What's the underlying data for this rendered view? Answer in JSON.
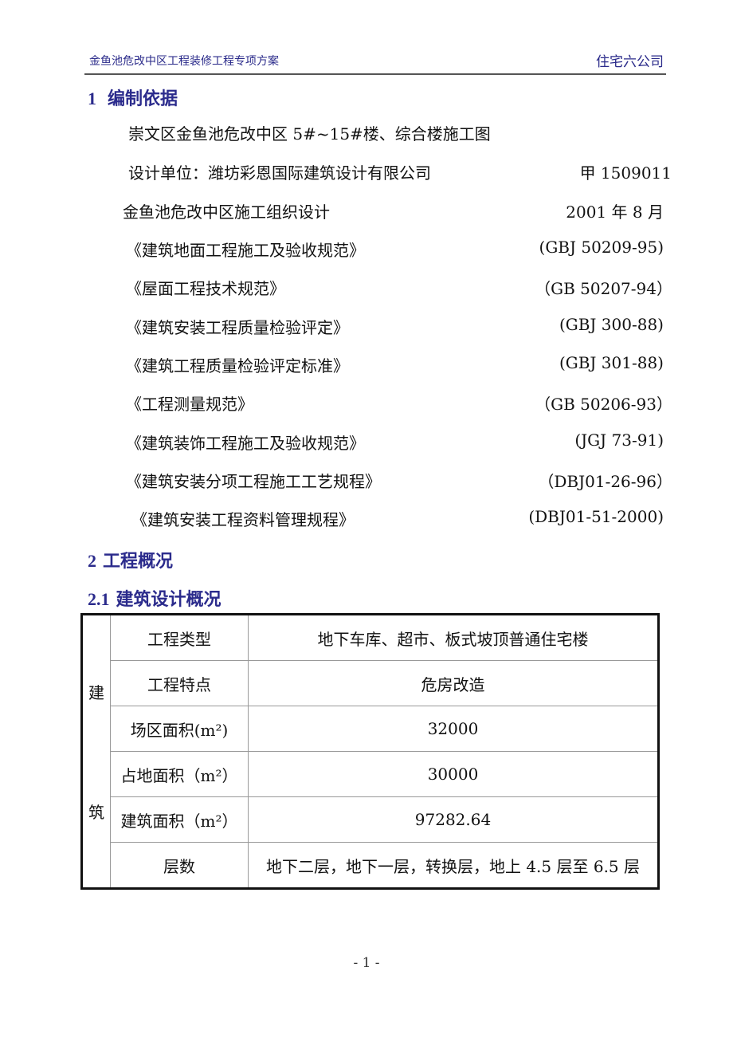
{
  "header": {
    "left": "金鱼池危改中区工程装修工程专项方案",
    "right": "住宅六公司"
  },
  "section1": {
    "number": "1",
    "title": "编制依据",
    "items": [
      {
        "text": "崇文区金鱼池危改中区 5#~15#楼、综合楼施工图",
        "code": ""
      },
      {
        "text": "设计单位：潍坊彩恩国际建筑设计有限公司",
        "code": "甲 1509011"
      },
      {
        "text": "金鱼池危改中区施工组织设计",
        "code": "2001 年 8 月"
      },
      {
        "text": "《建筑地面工程施工及验收规范》",
        "code": "(GBJ 50209-95)"
      },
      {
        "text": "《屋面工程技术规范》",
        "code": "（GB 50207-94）"
      },
      {
        "text": "《建筑安装工程质量检验评定》",
        "code": "(GBJ 300-88)"
      },
      {
        "text": "《建筑工程质量检验评定标准》",
        "code": "(GBJ 301-88)"
      },
      {
        "text": "《工程测量规范》",
        "code": "（GB 50206-93）"
      },
      {
        "text": "《建筑装饰工程施工及验收规范》",
        "code": "(JGJ 73-91)"
      },
      {
        "text": "《建筑安装分项工程施工工艺规程》",
        "code": "（DBJ01-26-96）"
      },
      {
        "text": "《建筑安装工程资料管理规程》",
        "code": "(DBJ01-51-2000)"
      }
    ]
  },
  "section2": {
    "number": "2",
    "title": "工程概况"
  },
  "section21": {
    "number": "2.1",
    "title": "建筑设计概况"
  },
  "table": {
    "side_label": [
      "建",
      "筑"
    ],
    "rows": [
      {
        "label": "工程类型",
        "value": "地下车库、超市、板式坡顶普通住宅楼"
      },
      {
        "label": "工程特点",
        "value": "危房改造"
      },
      {
        "label": "场区面积(m²)",
        "value": "32000"
      },
      {
        "label": "占地面积（m²）",
        "value": "30000"
      },
      {
        "label": "建筑面积（m²）",
        "value": "97282.64"
      },
      {
        "label": "层数",
        "value": "地下二层，地下一层，转换层，地上 4.5 层至 6.5 层"
      }
    ]
  },
  "footer": {
    "page": "- 1 -"
  }
}
